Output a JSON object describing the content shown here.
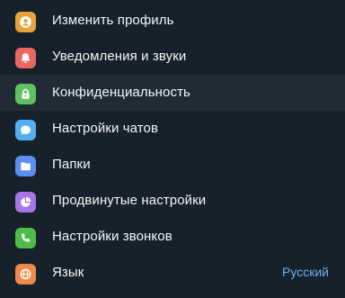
{
  "menu": {
    "items": [
      {
        "label": "Изменить профиль",
        "icon": "profile-icon",
        "color": "#e8a23a"
      },
      {
        "label": "Уведомления и звуки",
        "icon": "bell-icon",
        "color": "#e86761"
      },
      {
        "label": "Конфиденциальность",
        "icon": "lock-icon",
        "color": "#5fc15f"
      },
      {
        "label": "Настройки чатов",
        "icon": "chat-icon",
        "color": "#55aef0"
      },
      {
        "label": "Папки",
        "icon": "folder-icon",
        "color": "#5d8ef0"
      },
      {
        "label": "Продвинутые настройки",
        "icon": "pie-chart-icon",
        "color": "#a675e8"
      },
      {
        "label": "Настройки звонков",
        "icon": "phone-icon",
        "color": "#4fbb48"
      },
      {
        "label": "Язык",
        "icon": "globe-icon",
        "color": "#ed8a4c",
        "value": "Русский"
      }
    ]
  }
}
